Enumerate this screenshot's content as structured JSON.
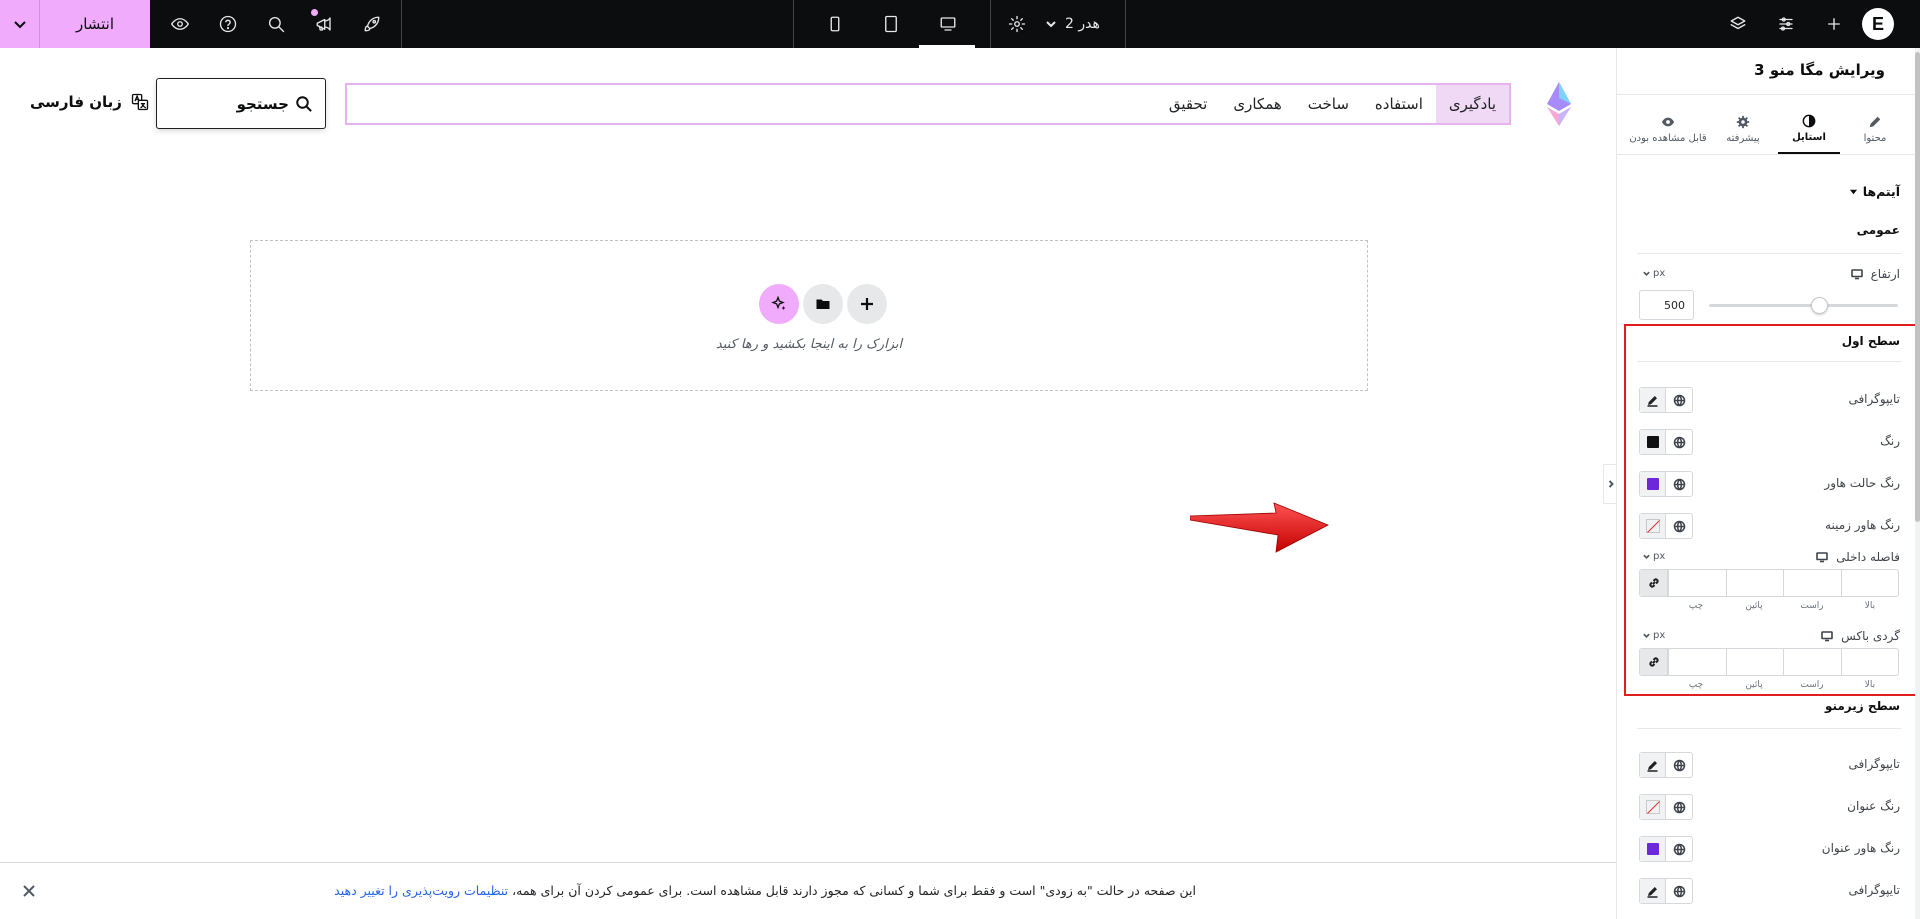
{
  "topbar": {
    "publish_label": "انتشار",
    "header_selector": "هدر 2",
    "active_device": "desktop",
    "brand_logo": "elementor-logo"
  },
  "canvas": {
    "nav_items": [
      "یادگیری",
      "استفاده",
      "ساخت",
      "همکاری",
      "تحقیق"
    ],
    "active_nav_index": 0,
    "search_label": "جستجو",
    "language_label": "زبان فارسی",
    "dropzone_text": "ابزارک را به اینجا بکشید و رها کنید",
    "colors": {
      "accent": "#f0abfc",
      "nav_active_bg": "#efd9f4",
      "highlight": "#e11d1d",
      "arrow": "#e11d1d"
    }
  },
  "notice": {
    "text": "این صفحه در حالت \"به زودی\" است و فقط برای شما و کسانی که مجوز دارند قابل مشاهده است. برای عمومی کردن آن برای همه، ",
    "link": "تنظیمات رویت‌پذیری را تغییر دهید"
  },
  "panel": {
    "title": "ویرایش مگا منو 3",
    "tabs": [
      {
        "label": "محتوا",
        "icon": "pencil-icon"
      },
      {
        "label": "استایل",
        "icon": "contrast-icon"
      },
      {
        "label": "پیشرفته",
        "icon": "gear-icon"
      },
      {
        "label": "قابل مشاهده بودن",
        "icon": "eye-icon"
      }
    ],
    "active_tab_index": 1,
    "section_title": "آیتم‌ها",
    "general_label": "عمومی",
    "height_label": "ارتفاع",
    "height_unit": "px",
    "height_value": "500",
    "height_slider_fraction": 0.42,
    "first_level": {
      "title": "سطح اول",
      "typography_label": "تایپوگرافی",
      "color_label": "رنگ",
      "color_value": "#111111",
      "hover_color_label": "رنگ حالت هاور",
      "hover_color_value": "#6d28d9",
      "hover_bg_label": "رنگ هاور زمینه",
      "padding_label": "فاصله داخلی",
      "padding_unit": "px",
      "radius_label": "گردی باکس",
      "radius_unit": "px",
      "dim_labels": [
        "بالا",
        "راست",
        "پائین",
        "چپ"
      ]
    },
    "submenu": {
      "title": "سطح زیرمنو",
      "typography_label": "تایپوگرافی",
      "title_color_label": "رنگ عنوان",
      "title_hover_color_label": "رنگ هاور عنوان",
      "title_hover_color_value": "#6d28d9",
      "typography2_label": "تایپوگرافی"
    }
  }
}
